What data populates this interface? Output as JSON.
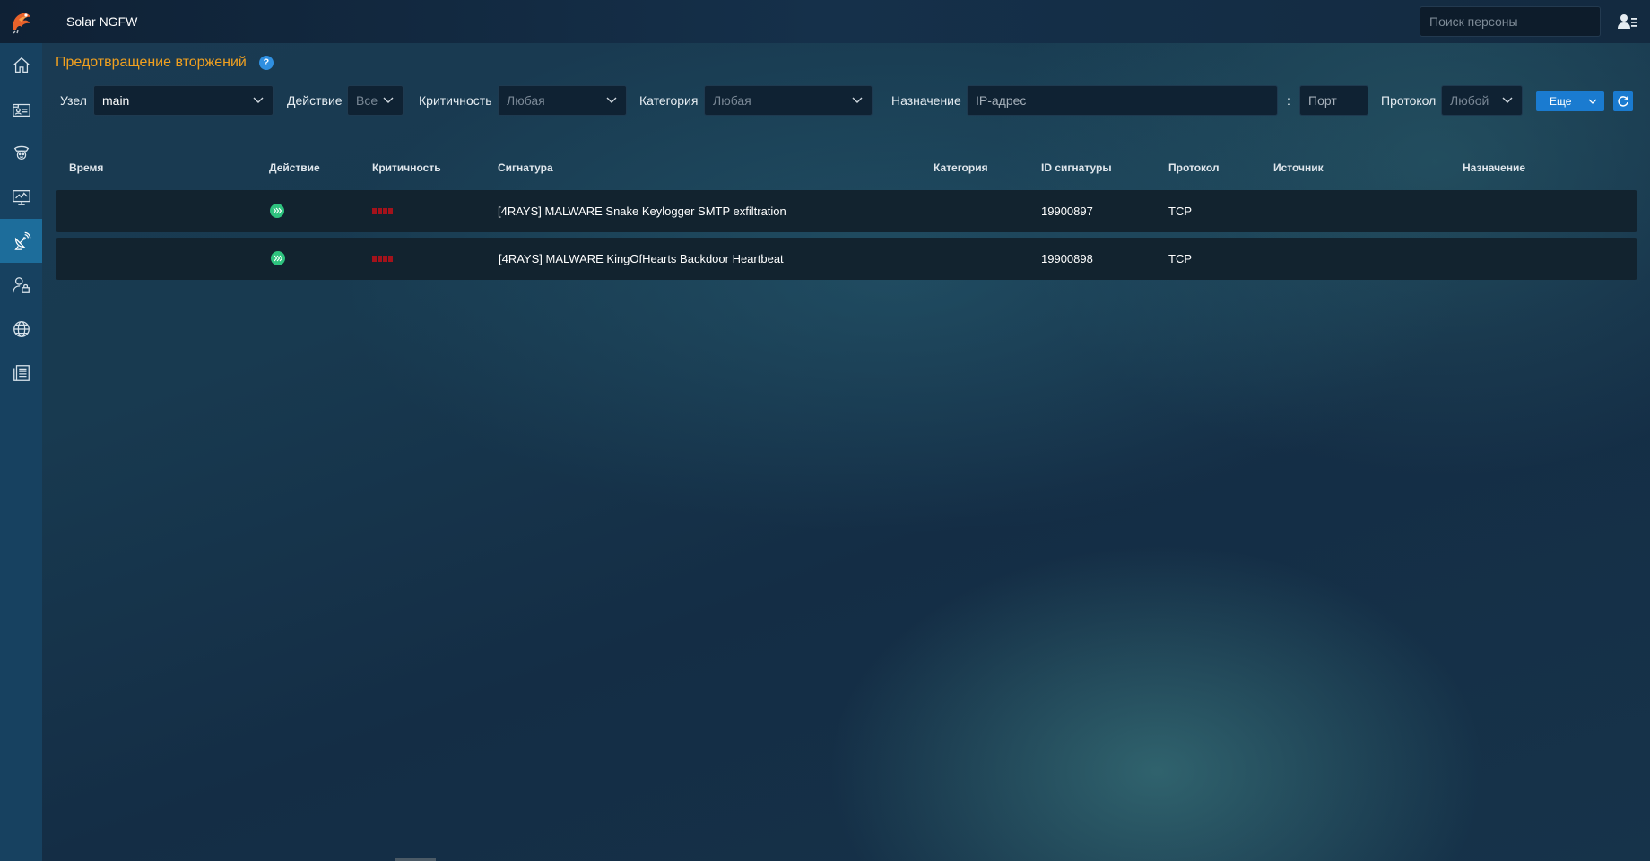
{
  "app": {
    "title": "Solar NGFW",
    "search_placeholder": "Поиск персоны",
    "icons": {
      "logo": "solar-logo-icon",
      "user": "user-menu-icon"
    }
  },
  "sidebar": {
    "items": [
      {
        "name": "home",
        "icon": "home-icon",
        "active": false
      },
      {
        "name": "identity",
        "icon": "id-card-icon",
        "active": false
      },
      {
        "name": "security",
        "icon": "police-badge-icon",
        "active": false
      },
      {
        "name": "monitoring",
        "icon": "monitor-chart-icon",
        "active": false
      },
      {
        "name": "intrusion-prevention",
        "icon": "satellite-dish-icon",
        "active": true
      },
      {
        "name": "users",
        "icon": "user-lock-icon",
        "active": false
      },
      {
        "name": "web",
        "icon": "globe-icon",
        "active": false
      },
      {
        "name": "logs",
        "icon": "document-list-icon",
        "active": false
      }
    ]
  },
  "page": {
    "title": "Предотвращение вторжений",
    "help": "?"
  },
  "filters": {
    "node_label": "Узел",
    "node_value": "main",
    "action_label": "Действие",
    "action_value": "Все",
    "severity_label": "Критичность",
    "severity_value": "Любая",
    "category_label": "Категория",
    "category_value": "Любая",
    "destination_label": "Назначение",
    "ip_placeholder": "IP-адрес",
    "port_separator": ":",
    "port_placeholder": "Порт",
    "protocol_label": "Протокол",
    "protocol_value": "Любой",
    "more_label": "Еще"
  },
  "table": {
    "columns": [
      "Время",
      "Действие",
      "Критичность",
      "Сигнатура",
      "Категория",
      "ID сигнатуры",
      "Протокол",
      "Источник",
      "Назначение"
    ],
    "rows": [
      {
        "time": "",
        "action": "pass",
        "severity": "high",
        "signature": "[4RAYS] MALWARE Snake Keylogger SMTP exfiltration",
        "category": "",
        "sig_id": "19900897",
        "protocol": "TCP",
        "source": "",
        "destination": ""
      },
      {
        "time": "",
        "action": "pass",
        "severity": "high",
        "signature": "[4RAYS] MALWARE KingOfHearts Backdoor Heartbeat",
        "category": "",
        "sig_id": "19900898",
        "protocol": "TCP",
        "source": "",
        "destination": ""
      }
    ]
  },
  "colors": {
    "accent_title": "#f0a020",
    "primary_button": "#1a7bd0",
    "action_pass": "#2ec27e",
    "severity_high": "#a3121b",
    "sidebar_active": "#1d6d9b"
  }
}
